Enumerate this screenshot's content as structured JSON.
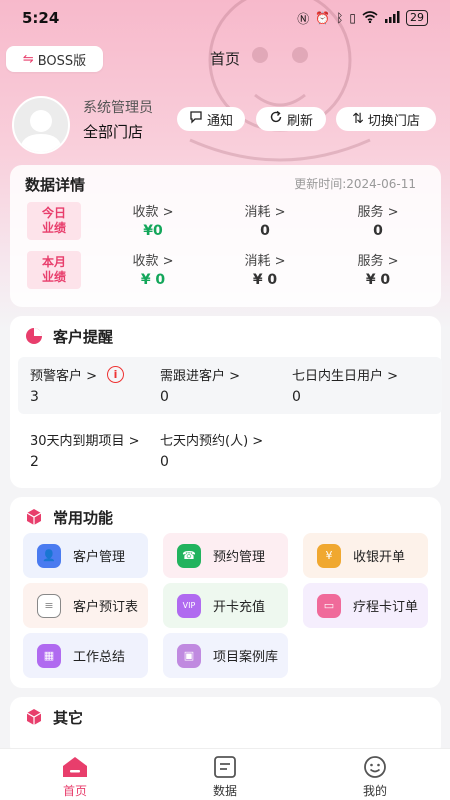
{
  "status_bar": {
    "time": "5:24",
    "battery": "29"
  },
  "header": {
    "boss_label": "BOSS版",
    "title": "首页"
  },
  "profile": {
    "role": "系统管理员",
    "store": "全部门店"
  },
  "actions": {
    "notify": "通知",
    "refresh": "刷新",
    "switch_store": "切换门店"
  },
  "data_details": {
    "title": "数据详情",
    "update_time": "更新时间:2024-06-11",
    "today": {
      "tag_top": "今日",
      "tag_bottom": "业绩",
      "income_label": "收款 >",
      "income_value": "¥0",
      "consume_label": "消耗 >",
      "consume_value": "0",
      "service_label": "服务 >",
      "service_value": "0"
    },
    "month": {
      "tag_top": "本月",
      "tag_bottom": "业绩",
      "income_label": "收款 >",
      "income_value": "¥ 0",
      "consume_label": "消耗 >",
      "consume_value": "¥ 0",
      "service_label": "服务 >",
      "service_value": "¥ 0"
    }
  },
  "customer_reminder": {
    "title": "客户提醒",
    "items": [
      {
        "label": "预警客户 >",
        "value": "3"
      },
      {
        "label": "需跟进客户 >",
        "value": "0"
      },
      {
        "label": "七日内生日用户 >",
        "value": "0"
      },
      {
        "label": "30天内到期项目 >",
        "value": "2"
      },
      {
        "label": "七天内预约(人) >",
        "value": "0"
      }
    ]
  },
  "common_functions": {
    "title": "常用功能",
    "items": [
      {
        "label": "客户管理",
        "icon": "customer-icon",
        "color": "#4a7bf0",
        "bg": "#eef2fd"
      },
      {
        "label": "预约管理",
        "icon": "appointment-icon",
        "color": "#22b35e",
        "bg": "#fdeef2"
      },
      {
        "label": "收银开单",
        "icon": "cashier-icon",
        "color": "#f0a830",
        "bg": "#fdf2ea"
      },
      {
        "label": "客户预订表",
        "icon": "booking-sheet-icon",
        "color": "#888888",
        "bg": "#fdf2ee"
      },
      {
        "label": "开卡充值",
        "icon": "card-recharge-icon",
        "color": "#b06af0",
        "bg": "#eef8ef"
      },
      {
        "label": "疗程卡订单",
        "icon": "course-card-icon",
        "color": "#f06a9a",
        "bg": "#f5eefd"
      },
      {
        "label": "工作总结",
        "icon": "work-summary-icon",
        "color": "#b06af0",
        "bg": "#f0f2fd"
      },
      {
        "label": "项目案例库",
        "icon": "case-library-icon",
        "color": "#c08ae0",
        "bg": "#f1f3fd"
      }
    ]
  },
  "other": {
    "title": "其它"
  },
  "tabbar": {
    "items": [
      {
        "label": "首页",
        "icon": "home-icon"
      },
      {
        "label": "数据",
        "icon": "data-icon"
      },
      {
        "label": "我的",
        "icon": "profile-icon"
      }
    ]
  },
  "colors": {
    "accent": "#e83e6c",
    "positive": "#13a65a"
  }
}
